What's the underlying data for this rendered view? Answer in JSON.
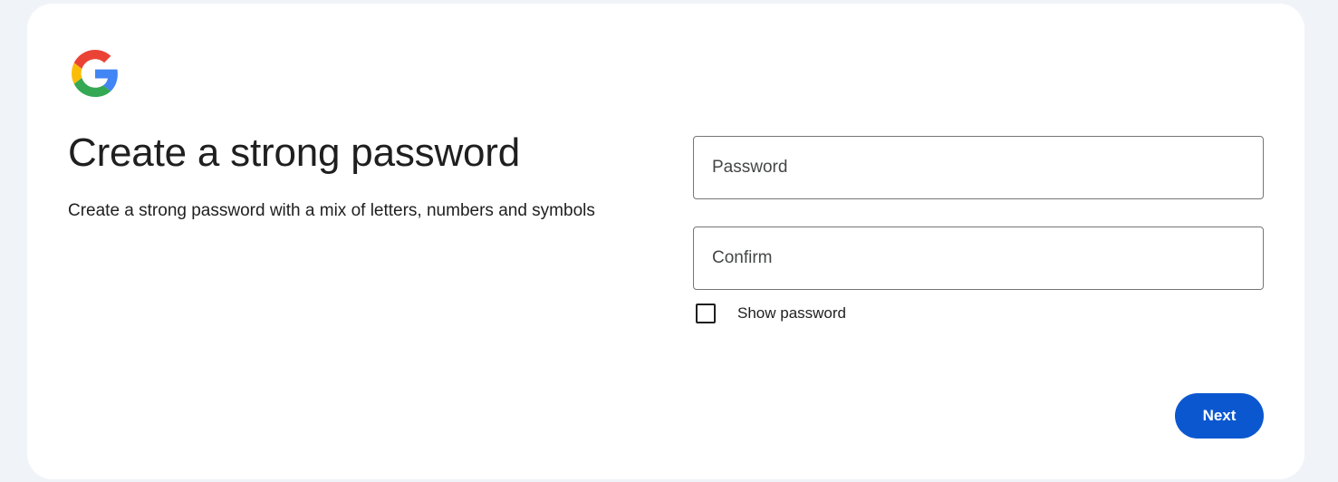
{
  "header": {
    "logo_icon": "google-g-icon",
    "title": "Create a strong password",
    "subtitle": "Create a strong password with a mix of letters, numbers and symbols"
  },
  "form": {
    "password": {
      "placeholder": "Password",
      "value": ""
    },
    "confirm": {
      "placeholder": "Confirm",
      "value": ""
    },
    "show_password": {
      "label": "Show password",
      "checked": false
    }
  },
  "actions": {
    "next_label": "Next"
  },
  "colors": {
    "page_background": "#f0f4f9",
    "card_background": "#ffffff",
    "primary_button": "#0b57d0",
    "field_border": "#747775",
    "text": "#1f1f1f",
    "google_blue": "#4285f4",
    "google_red": "#ea4335",
    "google_yellow": "#fbbc05",
    "google_green": "#34a853"
  }
}
